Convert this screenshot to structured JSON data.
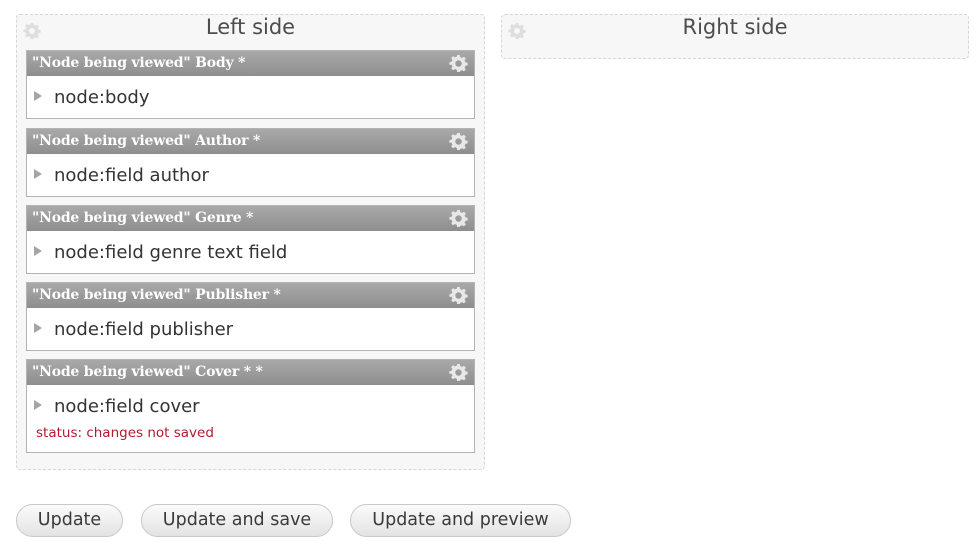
{
  "regions": {
    "left": {
      "title": "Left side"
    },
    "right": {
      "title": "Right side"
    }
  },
  "panes": [
    {
      "title": "\"Node being viewed\" Body *",
      "content": "node:body"
    },
    {
      "title": "\"Node being viewed\" Author *",
      "content": "node:field author"
    },
    {
      "title": "\"Node being viewed\" Genre *",
      "content": "node:field genre text field"
    },
    {
      "title": "\"Node being viewed\" Publisher *",
      "content": "node:field publisher"
    },
    {
      "title": "\"Node being viewed\" Cover * *",
      "content": "node:field cover",
      "status": "status: changes not saved"
    }
  ],
  "buttons": {
    "update": "Update",
    "update_and_save": "Update and save",
    "update_and_preview": "Update and preview"
  },
  "icons": {
    "region_settings": "gear-icon",
    "pane_settings": "gear-icon",
    "pane_expand": "triangle-right-icon"
  },
  "colors": {
    "pane_header": "#999999",
    "status_text": "#b01b2e",
    "region_background": "#f7f7f7"
  }
}
